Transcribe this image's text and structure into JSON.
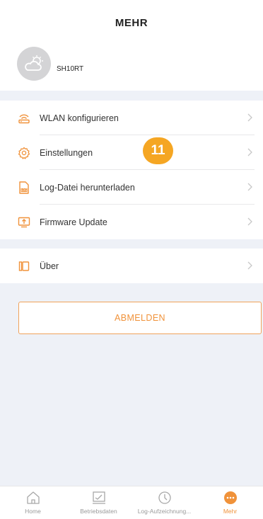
{
  "header": {
    "title": "MEHR"
  },
  "profile": {
    "device_name": "SH10RT"
  },
  "menu_group1": [
    {
      "label": "WLAN konfigurieren",
      "icon": "wifi-router-icon"
    },
    {
      "label": "Einstellungen",
      "icon": "gear-icon"
    },
    {
      "label": "Log-Datei herunterladen",
      "icon": "log-file-icon"
    },
    {
      "label": "Firmware Update",
      "icon": "firmware-update-icon"
    }
  ],
  "menu_group2": [
    {
      "label": "Über",
      "icon": "info-icon"
    }
  ],
  "annotation": {
    "badge": "11"
  },
  "logout": {
    "label": "ABMELDEN"
  },
  "tabbar": [
    {
      "label": "Home",
      "icon": "home-icon",
      "active": false
    },
    {
      "label": "Betriebsdaten",
      "icon": "chart-icon",
      "active": false
    },
    {
      "label": "Log-Aufzeichnung...",
      "icon": "clock-icon",
      "active": false
    },
    {
      "label": "Mehr",
      "icon": "more-icon",
      "active": true
    }
  ],
  "colors": {
    "accent": "#f0923a",
    "badge": "#f5a623",
    "background": "#eef1f7"
  }
}
